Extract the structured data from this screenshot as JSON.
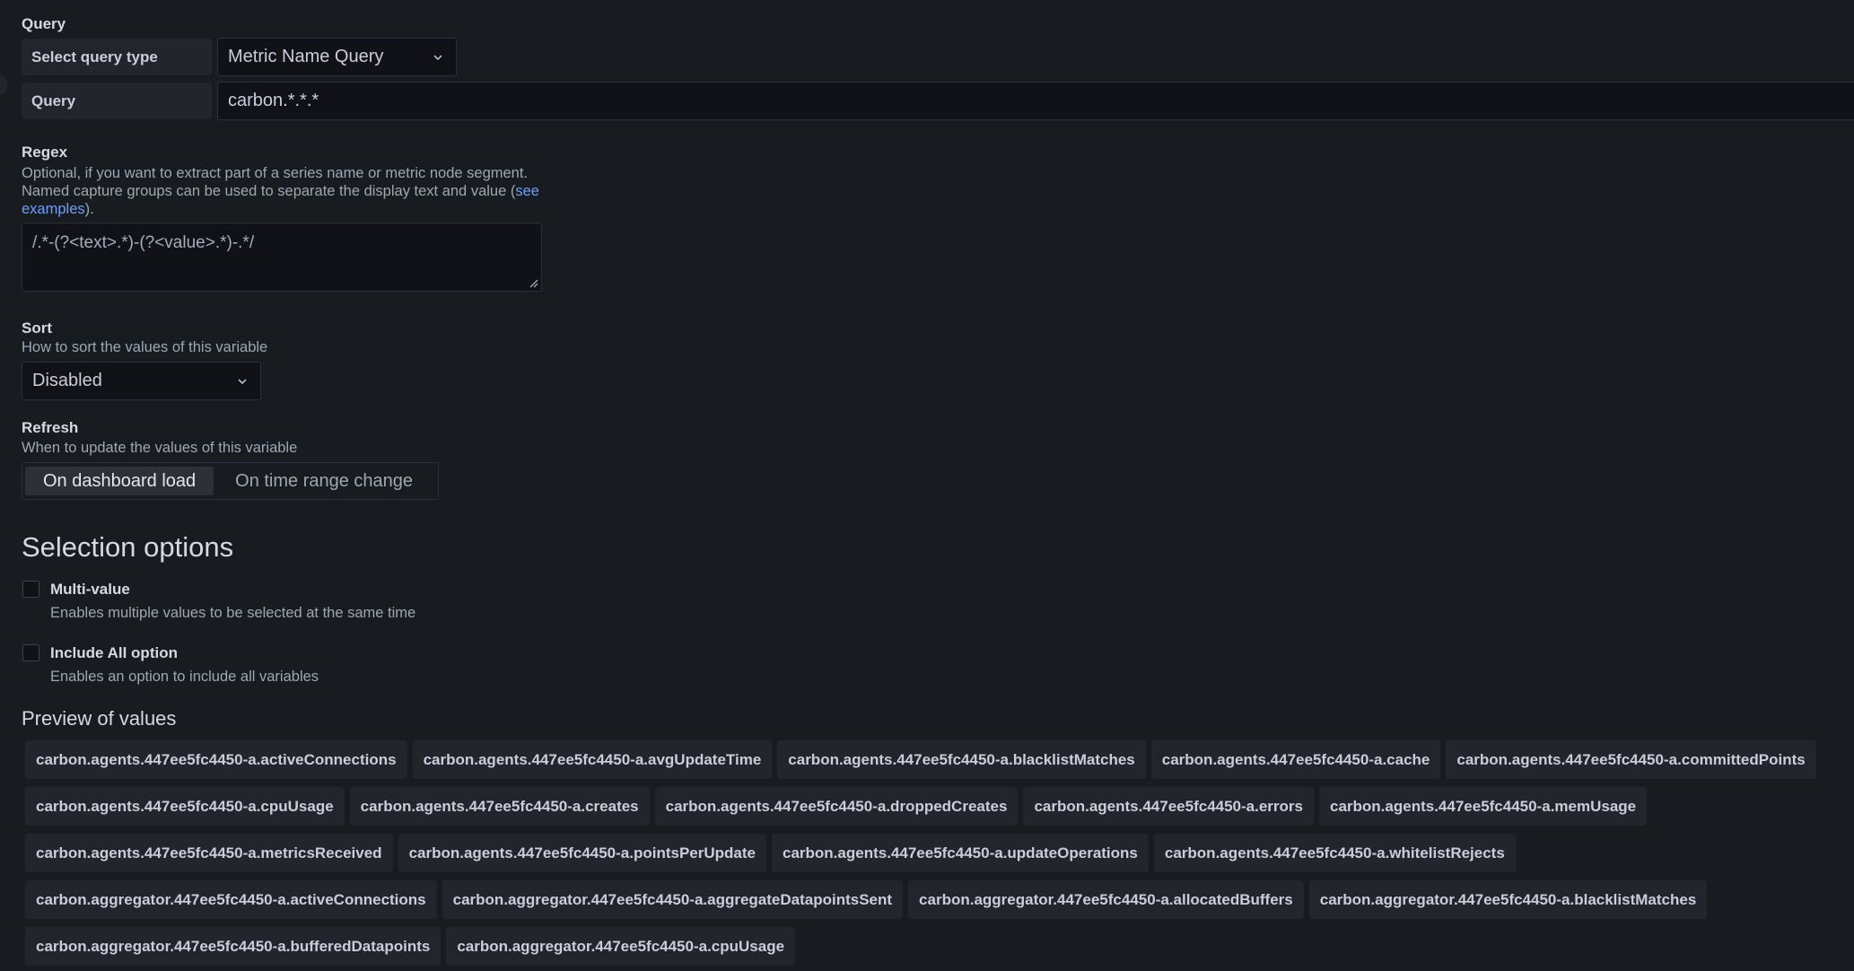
{
  "query_section": {
    "title": "Query",
    "query_type_label": "Select query type",
    "query_type_value": "Metric Name Query",
    "query_label": "Query",
    "query_value": "carbon.*.*.*"
  },
  "regex": {
    "title": "Regex",
    "desc_line1": "Optional, if you want to extract part of a series name or metric node segment.",
    "desc_line2_prefix": "Named capture groups can be used to separate the display text and value (",
    "link_part1": "see",
    "link_part2": "examples",
    "desc_suffix": ").",
    "value": "/.*-(?<text>.*)-(?<value>.*)-.*/"
  },
  "sort": {
    "title": "Sort",
    "description": "How to sort the values of this variable",
    "value": "Disabled"
  },
  "refresh": {
    "title": "Refresh",
    "description": "When to update the values of this variable",
    "options": [
      "On dashboard load",
      "On time range change"
    ],
    "selected": "On dashboard load"
  },
  "selection_options": {
    "title": "Selection options",
    "multi_value_label": "Multi-value",
    "multi_value_desc": "Enables multiple values to be selected at the same time",
    "multi_value_checked": false,
    "include_all_label": "Include All option",
    "include_all_desc": "Enables an option to include all variables",
    "include_all_checked": false
  },
  "preview": {
    "title": "Preview of values",
    "values": [
      "carbon.agents.447ee5fc4450-a.activeConnections",
      "carbon.agents.447ee5fc4450-a.avgUpdateTime",
      "carbon.agents.447ee5fc4450-a.blacklistMatches",
      "carbon.agents.447ee5fc4450-a.cache",
      "carbon.agents.447ee5fc4450-a.committedPoints",
      "carbon.agents.447ee5fc4450-a.cpuUsage",
      "carbon.agents.447ee5fc4450-a.creates",
      "carbon.agents.447ee5fc4450-a.droppedCreates",
      "carbon.agents.447ee5fc4450-a.errors",
      "carbon.agents.447ee5fc4450-a.memUsage",
      "carbon.agents.447ee5fc4450-a.metricsReceived",
      "carbon.agents.447ee5fc4450-a.pointsPerUpdate",
      "carbon.agents.447ee5fc4450-a.updateOperations",
      "carbon.agents.447ee5fc4450-a.whitelistRejects",
      "carbon.aggregator.447ee5fc4450-a.activeConnections",
      "carbon.aggregator.447ee5fc4450-a.aggregateDatapointsSent",
      "carbon.aggregator.447ee5fc4450-a.allocatedBuffers",
      "carbon.aggregator.447ee5fc4450-a.blacklistMatches",
      "carbon.aggregator.447ee5fc4450-a.bufferedDatapoints",
      "carbon.aggregator.447ee5fc4450-a.cpuUsage"
    ]
  },
  "icons": {
    "dropdown": "chevron-down-icon",
    "resize": "resize-handle-icon"
  }
}
